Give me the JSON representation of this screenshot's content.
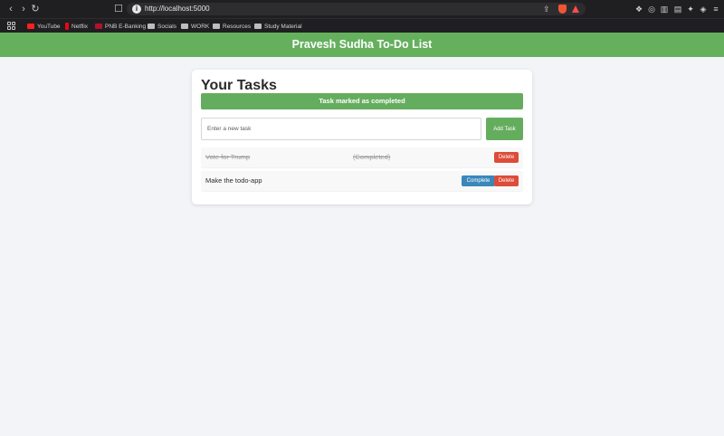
{
  "browser": {
    "url": "http://localhost:5000",
    "bookmarks": [
      {
        "label": "YouTube",
        "icon": "youtube-icon"
      },
      {
        "label": "Netflix",
        "icon": "netflix-icon"
      },
      {
        "label": "PNB E-Banking",
        "icon": "pnb-icon"
      },
      {
        "label": "Socials",
        "icon": "folder-icon"
      },
      {
        "label": "WORK",
        "icon": "folder-icon"
      },
      {
        "label": "Resources",
        "icon": "folder-icon"
      },
      {
        "label": "Study Material",
        "icon": "folder-icon"
      }
    ]
  },
  "app": {
    "title": "Pravesh Sudha To-Do List",
    "brand_color": "#64b05d"
  },
  "main": {
    "heading": "Your Tasks",
    "flash_message": "Task marked as completed",
    "new_task_placeholder": "Enter a new task",
    "add_button_label": "Add Task"
  },
  "tasks": [
    {
      "text": "Vote for Trump",
      "status": "(Completed)",
      "completed": true,
      "delete_label": "Delete"
    },
    {
      "text": "Make the todo-app",
      "completed": false,
      "complete_label": "Complete",
      "delete_label": "Delete"
    }
  ],
  "colors": {
    "delete": "#dd4b39",
    "complete": "#3a87ba",
    "success": "#65ad5e"
  }
}
